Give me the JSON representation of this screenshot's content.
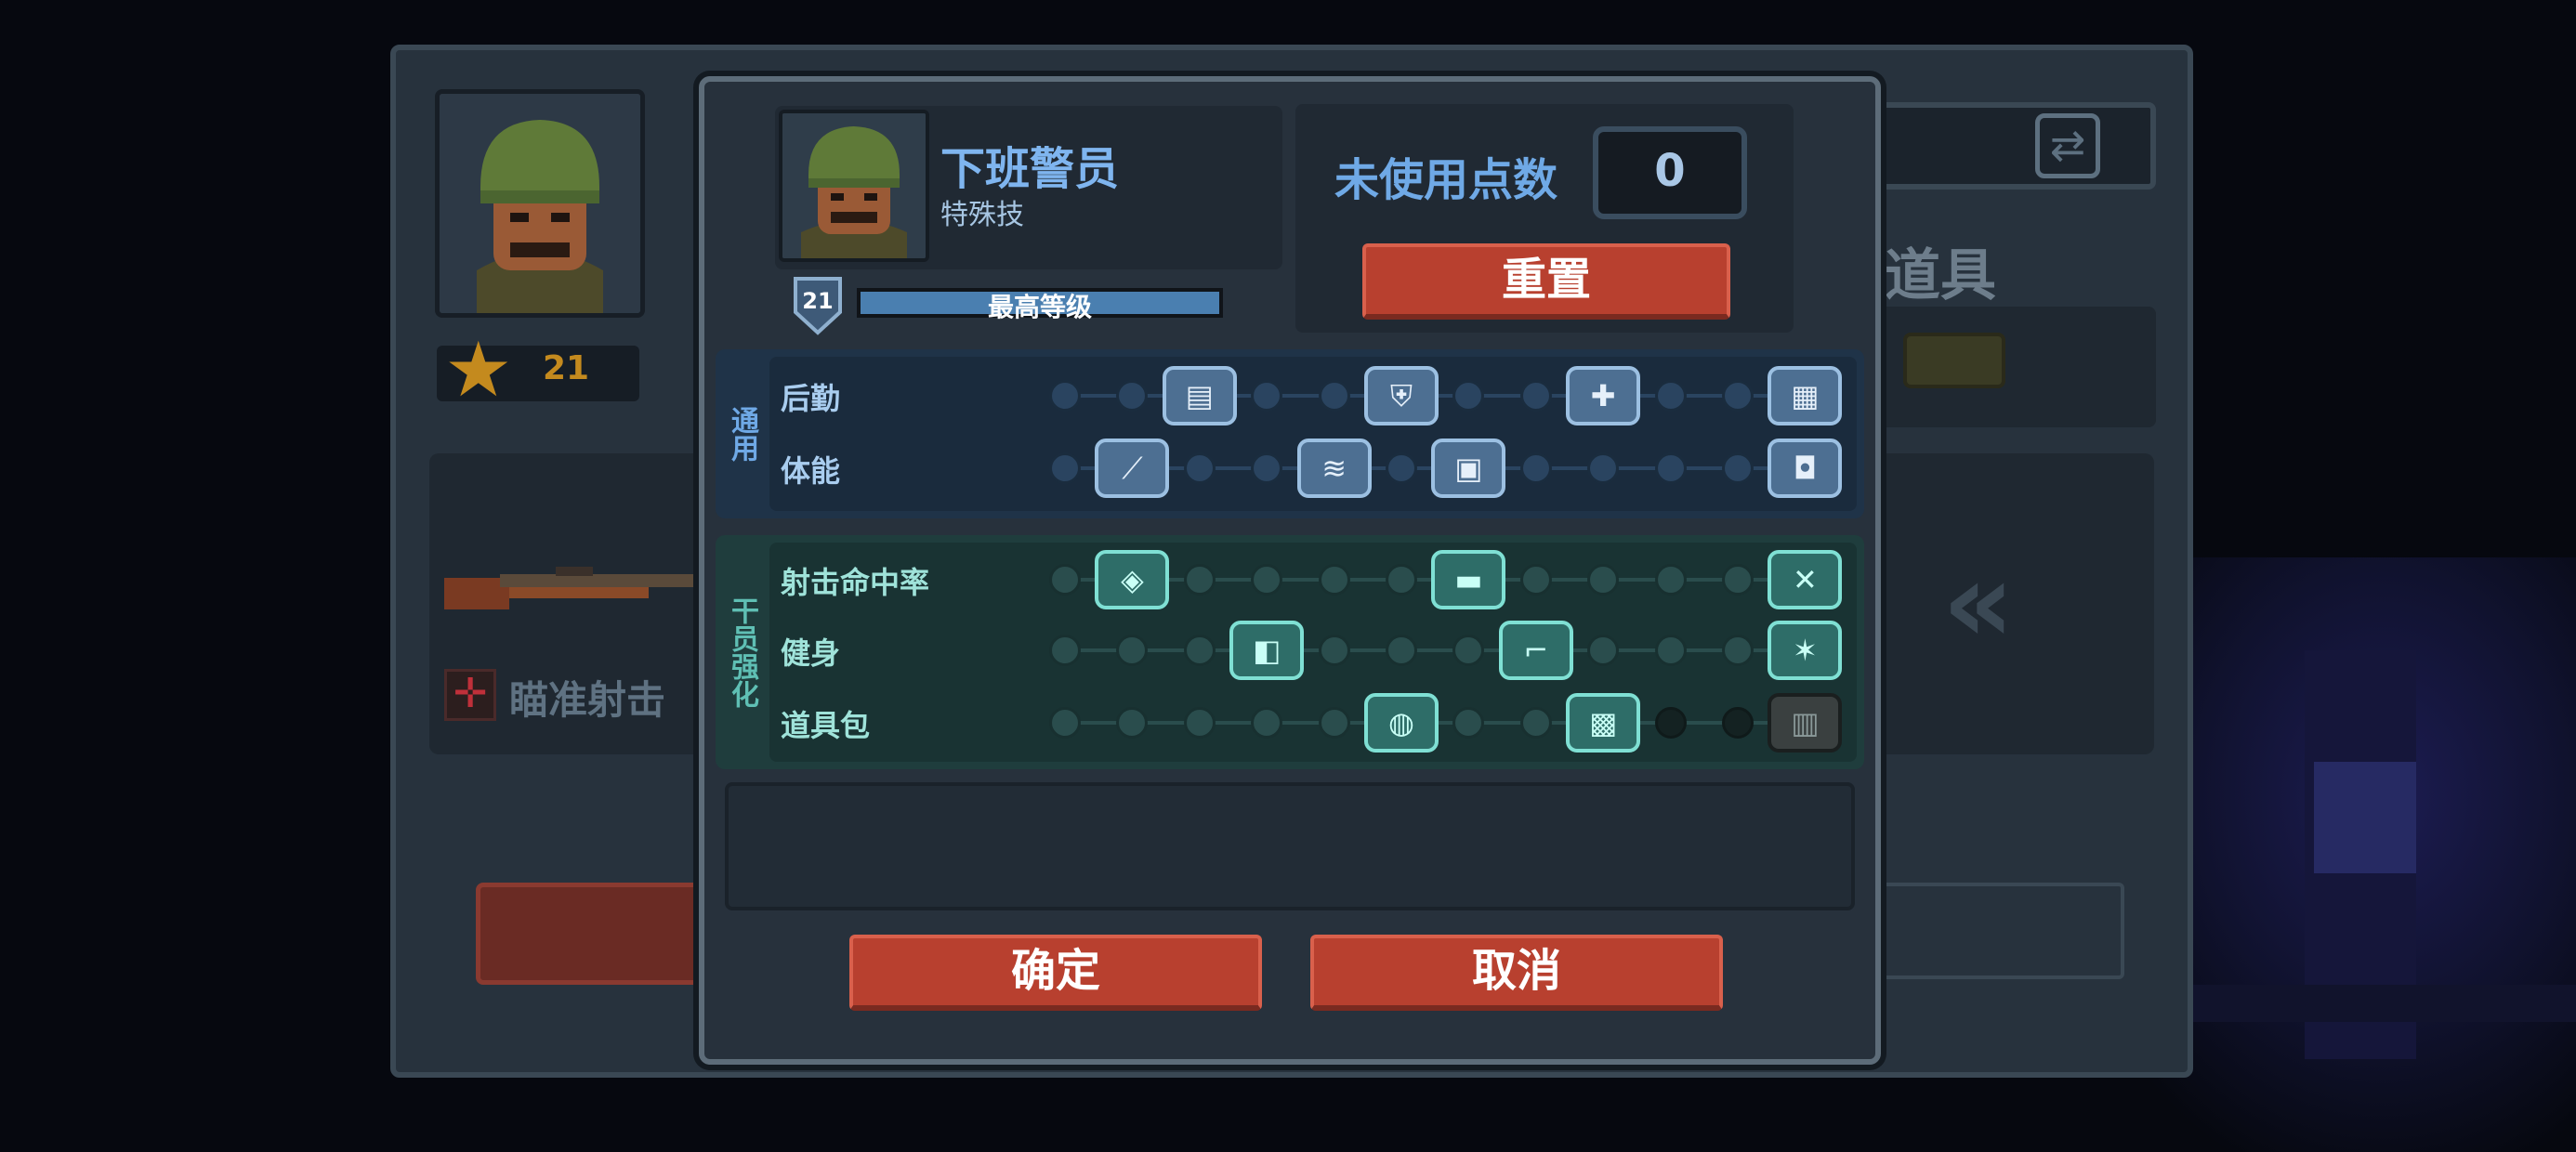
{
  "background": {
    "level": "21",
    "items_title": "道具",
    "skill_label": "瞄准射击",
    "swap_icon": "swap-icon",
    "chevron_icon": "double-chevron-left-icon"
  },
  "hero": {
    "name": "下班警员",
    "subtitle": "特殊技",
    "level": "21",
    "level_text": "最高等级",
    "level_progress": 1.0
  },
  "points": {
    "label": "未使用点数",
    "value": "0",
    "reset_label": "重置"
  },
  "sections": {
    "general": {
      "tab": "通用",
      "rows": [
        {
          "label": "后勤",
          "nodes": [
            2,
            5,
            8,
            11
          ],
          "icons": [
            "supply-crate-icon",
            "shield-plus-icon",
            "medkit-icon",
            "ammo-box-icon"
          ]
        },
        {
          "label": "体能",
          "nodes": [
            1,
            4,
            6,
            11
          ],
          "icons": [
            "knife-icon",
            "wing-boot-icon",
            "armor-plate-icon",
            "backpack-icon"
          ]
        }
      ]
    },
    "agent": {
      "tab": "干员强化",
      "rows": [
        {
          "label": "射击命中率",
          "nodes": [
            1,
            6,
            11
          ],
          "dim_from": null,
          "icons": [
            "bullet-icon",
            "gun-icon",
            "crosshair-icon"
          ]
        },
        {
          "label": "健身",
          "nodes": [
            3,
            7,
            11
          ],
          "dim_from": null,
          "icons": [
            "fist-icon",
            "grenade-launcher-icon",
            "running-man-icon"
          ]
        },
        {
          "label": "道具包",
          "nodes": [
            5,
            8,
            11
          ],
          "dim_from": 9,
          "icons": [
            "pouch-icon",
            "tank-icon",
            "locked-item-icon"
          ]
        }
      ]
    }
  },
  "buttons": {
    "confirm": "确定",
    "cancel": "取消"
  },
  "colors": {
    "accent_red": "#b8402f",
    "general_blue": "#9cc0e2",
    "agent_teal": "#7fe0d4",
    "level_gold": "#c48a1e"
  }
}
